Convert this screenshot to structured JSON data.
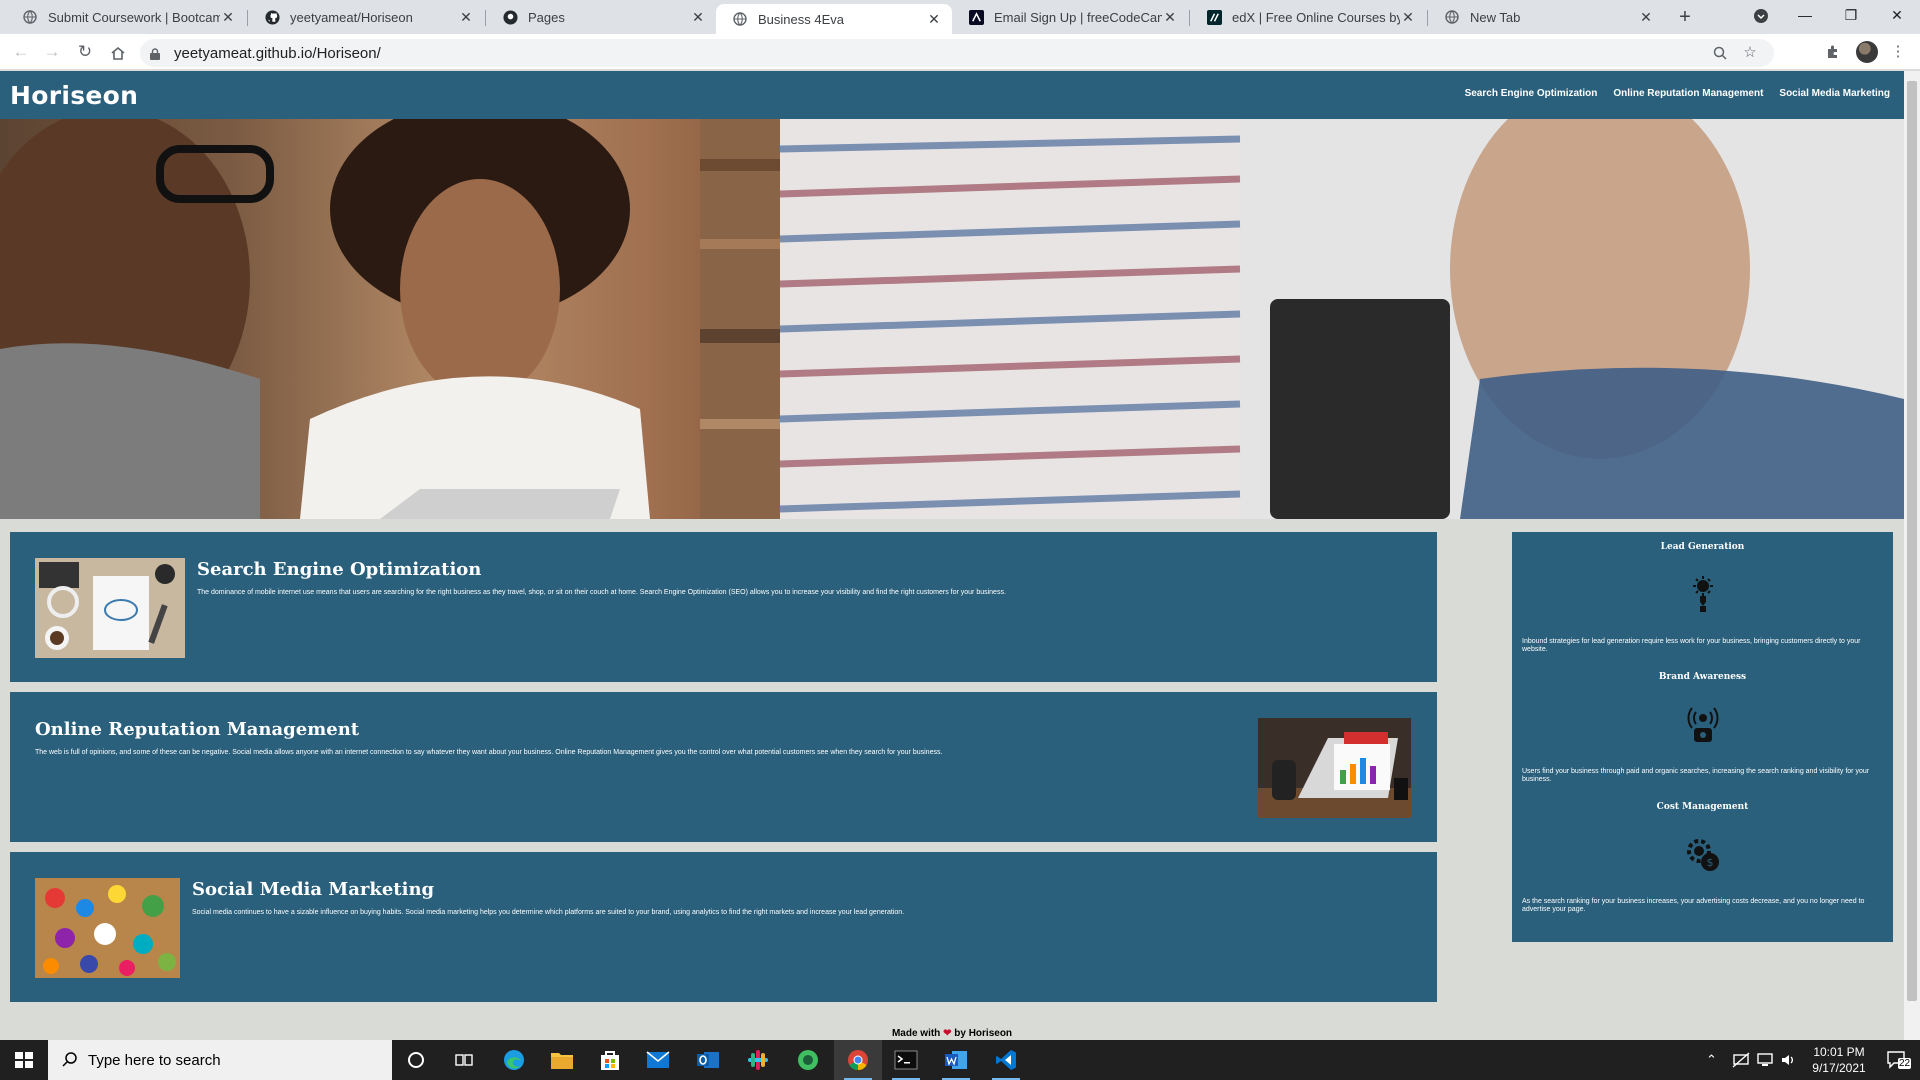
{
  "browser": {
    "tabs": [
      {
        "title": "Submit Coursework | Bootcamp",
        "icon": "globe-icon",
        "active": false
      },
      {
        "title": "yeetyameat/Horiseon",
        "icon": "github-icon",
        "active": false
      },
      {
        "title": "Pages",
        "icon": "github-icon",
        "active": false
      },
      {
        "title": "Business 4Eva",
        "icon": "globe-icon",
        "active": true
      },
      {
        "title": "Email Sign Up | freeCodeCamp.o",
        "icon": "freecodecamp-icon",
        "active": false
      },
      {
        "title": "edX | Free Online Courses by Ha",
        "icon": "edx-icon",
        "active": false
      },
      {
        "title": "New Tab",
        "icon": "globe-icon",
        "active": false
      }
    ],
    "url": "yeetyameat.github.io/Horiseon/"
  },
  "site": {
    "logo": "Horiseon",
    "nav": [
      "Search Engine Optimization",
      "Online Reputation Management",
      "Social Media Marketing"
    ],
    "sections": [
      {
        "title": "Search Engine Optimization",
        "text": "The dominance of mobile internet use means that users are searching for the right business as they travel, shop, or sit on their couch at home. Search Engine Optimization (SEO) allows you to increase your visibility and find the right customers for your business."
      },
      {
        "title": "Online Reputation Management",
        "text": "The web is full of opinions, and some of these can be negative. Social media allows anyone with an internet connection to say whatever they want about your business. Online Reputation Management gives you the control over what potential customers see when they search for your business."
      },
      {
        "title": "Social Media Marketing",
        "text": "Social media continues to have a sizable influence on buying habits. Social media marketing helps you determine which platforms are suited to your brand, using analytics to find the right markets and increase your lead generation."
      }
    ],
    "benefits": [
      {
        "title": "Lead Generation",
        "text": "Inbound strategies for lead generation require less work for your business, bringing customers directly to your website."
      },
      {
        "title": "Brand Awareness",
        "text": "Users find your business through paid and organic searches, increasing the search ranking and visibility for your business."
      },
      {
        "title": "Cost Management",
        "text": "As the search ranking for your business increases, your advertising costs decrease, and you no longer need to advertise your page."
      }
    ],
    "footer": {
      "prefix": "Made with",
      "suffix": "by Horiseon"
    }
  },
  "taskbar": {
    "search_placeholder": "Type here to search",
    "time": "10:01 PM",
    "date": "9/17/2021",
    "notifications": "22"
  }
}
